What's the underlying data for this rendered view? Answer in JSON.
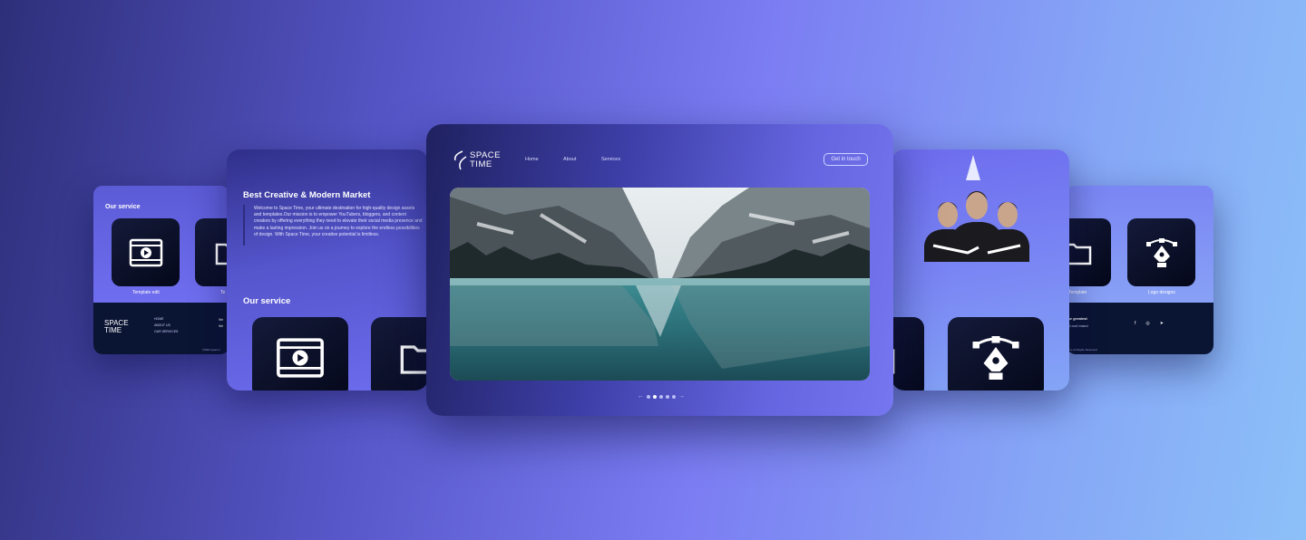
{
  "page": {
    "background_colors": [
      "#2e2f7a",
      "#7b7cf2",
      "#8cc0f8"
    ]
  },
  "brand": {
    "line1": "SPACE",
    "line2": "TIME"
  },
  "far_left_card": {
    "section_title": "Our service",
    "tiles": [
      {
        "icon": "video-icon",
        "caption": "Template edit"
      },
      {
        "icon": "folder-icon",
        "caption": "Te"
      }
    ],
    "footer": {
      "links": [
        "HOME",
        "ABOUT US",
        "OUR SERVICES"
      ],
      "more": [
        "We",
        "We"
      ],
      "copyright": "©2024 space ti"
    }
  },
  "left_card": {
    "heading": "Best Creative & Modern Market",
    "paragraph": "Welcome to Space Time, your ultimate destination for high-quality design assets and templates.Our mission is to empower YouTubers, bloggers, and content creators by offering everything they need to elevate their social media presence and make a lasting impression. Join us on a journey to explore the endless possibilities of design. With Space Time, your creative potential is limitless.",
    "section_title": "Our service",
    "tiles": [
      {
        "icon": "video-icon"
      },
      {
        "icon": "folder-icon"
      }
    ]
  },
  "main_card": {
    "nav": [
      {
        "label": "Home"
      },
      {
        "label": "About"
      },
      {
        "label": "Services"
      }
    ],
    "cta": "Get in touch",
    "hero_image": "mountain-lake-reflection",
    "pager": {
      "count": 5,
      "active": 2
    }
  },
  "right_card": {
    "image": "team-of-three-men",
    "tiles": [
      {
        "icon": "folder-icon"
      },
      {
        "icon": "pen-tool-icon"
      }
    ]
  },
  "far_right_card": {
    "tiles": [
      {
        "icon": "folder-icon",
        "caption": "Template"
      },
      {
        "icon": "pen-tool-icon",
        "caption": "Logo designs"
      }
    ],
    "footer": {
      "head1": "the greatest",
      "head2": "nd and brand",
      "social": [
        "f",
        "◎",
        "➤"
      ],
      "copyright": "Time All Rights Reserved"
    }
  }
}
